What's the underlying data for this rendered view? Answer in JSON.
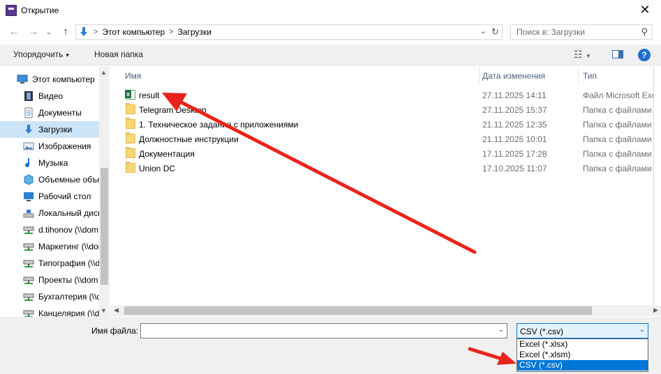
{
  "window": {
    "title": "Открытие",
    "close_glyph": "✕"
  },
  "nav": {
    "back_glyph": "←",
    "forward_glyph": "→",
    "recent_glyph": "⌄",
    "up_glyph": "↑",
    "breadcrumb": [
      "Этот компьютер",
      "Загрузки"
    ],
    "crumb_sep": ">",
    "dropdown_glyph": "⌄",
    "refresh_glyph": "↻",
    "search_placeholder": "Поиск в: Загрузки",
    "search_glyph": "⚲"
  },
  "toolbar": {
    "organize_label": "Упорядочить",
    "organize_caret": "▾",
    "new_folder_label": "Новая папка",
    "view_glyph": "☷",
    "view_caret": "▾",
    "help_glyph": "?"
  },
  "sidebar": {
    "items": [
      {
        "label": "Этот компьютер",
        "icon": "computer-icon",
        "selected": false,
        "indent": false
      },
      {
        "label": "Видео",
        "icon": "video-icon",
        "selected": false,
        "indent": true
      },
      {
        "label": "Документы",
        "icon": "documents-icon",
        "selected": false,
        "indent": true
      },
      {
        "label": "Загрузки",
        "icon": "downloads-icon",
        "selected": true,
        "indent": true
      },
      {
        "label": "Изображения",
        "icon": "pictures-icon",
        "selected": false,
        "indent": true
      },
      {
        "label": "Музыка",
        "icon": "music-icon",
        "selected": false,
        "indent": true
      },
      {
        "label": "Объемные объекты",
        "icon": "3d-objects-icon",
        "selected": false,
        "indent": true
      },
      {
        "label": "Рабочий стол",
        "icon": "desktop-icon",
        "selected": false,
        "indent": true
      },
      {
        "label": "Локальный диск (C:)",
        "icon": "local-disk-icon",
        "selected": false,
        "indent": true
      },
      {
        "label": "d.tihonov (\\\\dom",
        "icon": "network-drive-icon",
        "selected": false,
        "indent": true
      },
      {
        "label": "Маркетинг (\\\\dom",
        "icon": "network-drive-icon",
        "selected": false,
        "indent": true
      },
      {
        "label": "Типография (\\\\dom",
        "icon": "network-drive-icon",
        "selected": false,
        "indent": true
      },
      {
        "label": "Проекты (\\\\dom",
        "icon": "network-drive-icon",
        "selected": false,
        "indent": true
      },
      {
        "label": "Бухгалтерия (\\\\dom",
        "icon": "network-drive-icon",
        "selected": false,
        "indent": true
      },
      {
        "label": "Канцелярия (\\\\dom",
        "icon": "network-drive-icon",
        "selected": false,
        "indent": true
      }
    ],
    "scroll_up_glyph": "▲",
    "scroll_down_glyph": "▼"
  },
  "files": {
    "columns": {
      "name": "Имя",
      "date": "Дата изменения",
      "type": "Тип"
    },
    "sort_glyph": "⌃",
    "rows": [
      {
        "name": "result",
        "date": "27.11.2025 14:11",
        "type": "Файл Microsoft Excel",
        "icon": "excel-icon"
      },
      {
        "name": "Telegram Desktop",
        "date": "27.11.2025 15:37",
        "type": "Папка с файлами",
        "icon": "folder-icon"
      },
      {
        "name": "1. Техническое задание с приложениями",
        "date": "21.11.2025 12:35",
        "type": "Папка с файлами",
        "icon": "folder-icon"
      },
      {
        "name": "Должностные инструкции",
        "date": "21.11.2025 10:01",
        "type": "Папка с файлами",
        "icon": "folder-icon"
      },
      {
        "name": "Документация",
        "date": "17.11.2025 17:28",
        "type": "Папка с файлами",
        "icon": "folder-icon"
      },
      {
        "name": "Union DC",
        "date": "17.10.2025 11:07",
        "type": "Папка с файлами",
        "icon": "folder-icon"
      }
    ],
    "hscroll_left_glyph": "◀",
    "hscroll_right_glyph": "▶"
  },
  "bottom": {
    "filename_label": "Имя файла:",
    "filename_value": "",
    "filename_drop_glyph": "⌄",
    "filetype_selected": "CSV (*.csv)",
    "filetype_drop_glyph": "⌄",
    "filetype_options": [
      "Excel (*.xlsx)",
      "Excel (*.xlsm)",
      "CSV (*.csv)"
    ],
    "filetype_highlighted_index": 2
  },
  "colors": {
    "accent": "#0078d7",
    "selection": "#cce4f7",
    "annotation_arrow": "#e8241c"
  }
}
